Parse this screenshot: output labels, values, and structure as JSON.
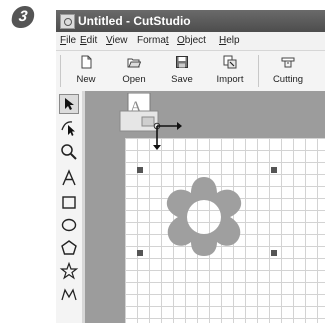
{
  "step": {
    "number": "3"
  },
  "window": {
    "title": "Untitled - CutStudio"
  },
  "menu": [
    {
      "pre": "",
      "u": "F",
      "post": "ile"
    },
    {
      "pre": "",
      "u": "E",
      "post": "dit"
    },
    {
      "pre": "",
      "u": "V",
      "post": "iew"
    },
    {
      "pre": "Forma",
      "u": "t",
      "post": ""
    },
    {
      "pre": "",
      "u": "O",
      "post": "bject"
    },
    {
      "pre": "",
      "u": "H",
      "post": "elp"
    }
  ],
  "toolbar": {
    "new_label": "New",
    "open_label": "Open",
    "save_label": "Save",
    "import_label": "Import",
    "cutting_label": "Cutting"
  },
  "tools": [
    {
      "name": "select-arrow-tool",
      "active": true
    },
    {
      "name": "node-edit-tool",
      "active": false
    },
    {
      "name": "zoom-tool",
      "active": false
    },
    {
      "name": "text-tool",
      "active": false
    },
    {
      "name": "rectangle-tool",
      "active": false
    },
    {
      "name": "ellipse-tool",
      "active": false
    },
    {
      "name": "polygon-tool",
      "active": false
    },
    {
      "name": "star-tool",
      "active": false
    },
    {
      "name": "curve-tool",
      "active": false
    }
  ],
  "cursor": {
    "tile_letter": "A"
  },
  "shape": {
    "type": "flower",
    "fill": "#9f9f9f"
  },
  "colors": {
    "titlebar": "#555555",
    "canvas_bg": "#9c9c9c",
    "grid": "#d3d3d3",
    "badge": "#555555"
  }
}
